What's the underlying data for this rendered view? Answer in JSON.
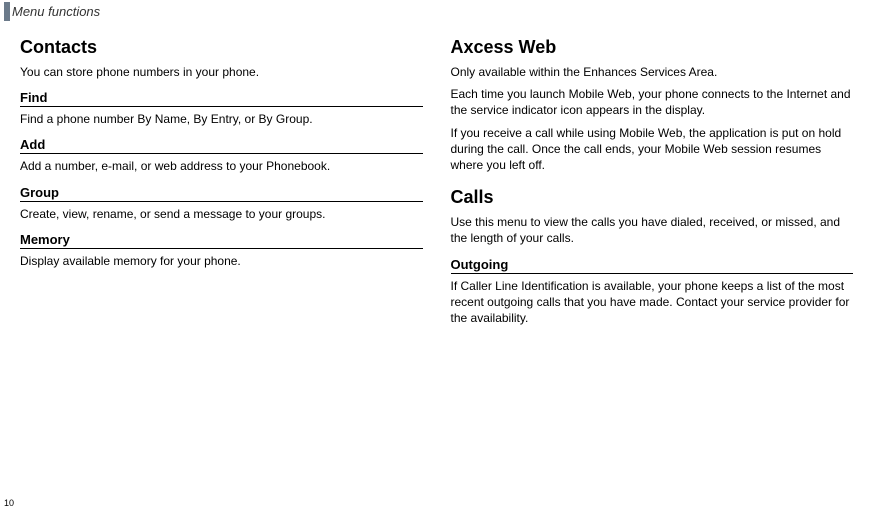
{
  "header": {
    "title": "Menu functions"
  },
  "left": {
    "contacts": {
      "title": "Contacts",
      "intro": "You can store phone numbers in your phone.",
      "find": {
        "heading": "Find",
        "text": "Find a phone number By Name, By Entry, or By Group."
      },
      "add": {
        "heading": "Add",
        "text": "Add a number, e-mail, or web address to your Phonebook."
      },
      "group": {
        "heading": "Group",
        "text": "Create, view, rename, or send a message to your groups."
      },
      "memory": {
        "heading": "Memory",
        "text": "Display available memory for your phone."
      }
    }
  },
  "right": {
    "axcess": {
      "title": "Axcess Web",
      "p1": "Only available within the Enhances Services Area.",
      "p2": "Each time you launch Mobile Web, your phone connects to the Internet and the service indicator icon appears in the display.",
      "p3": "If you receive a call while using Mobile Web, the application is put on hold during the call. Once the call ends, your Mobile Web session resumes where you left off."
    },
    "calls": {
      "title": "Calls",
      "intro": "Use this menu to view the calls you have dialed, received, or missed, and the length of your calls.",
      "outgoing": {
        "heading": "Outgoing",
        "text": "If Caller Line Identification is available, your phone keeps a list of the most recent outgoing calls that you have made. Contact your service provider for the availability."
      }
    }
  },
  "page_number": "10"
}
